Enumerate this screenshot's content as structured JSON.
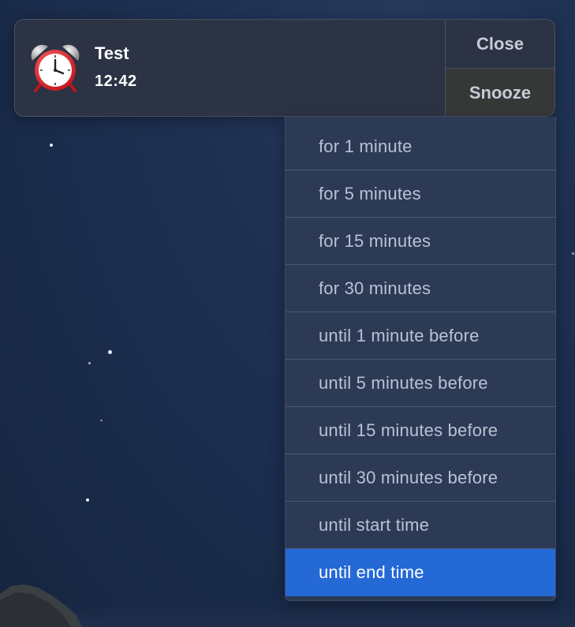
{
  "notification": {
    "icon": "alarm-clock-icon",
    "title": "Test",
    "time": "12:42",
    "close_label": "Close",
    "snooze_label": "Snooze"
  },
  "snooze_menu": {
    "items": [
      {
        "label": "for 1 minute",
        "selected": false
      },
      {
        "label": "for 5 minutes",
        "selected": false
      },
      {
        "label": "for 15 minutes",
        "selected": false
      },
      {
        "label": "for 30 minutes",
        "selected": false
      },
      {
        "label": "until 1 minute before",
        "selected": false
      },
      {
        "label": "until 5 minutes before",
        "selected": false
      },
      {
        "label": "until 15 minutes before",
        "selected": false
      },
      {
        "label": "until 30 minutes before",
        "selected": false
      },
      {
        "label": "until start time",
        "selected": false
      },
      {
        "label": "until end time",
        "selected": true
      }
    ],
    "highlight_color": "#2469d6"
  }
}
